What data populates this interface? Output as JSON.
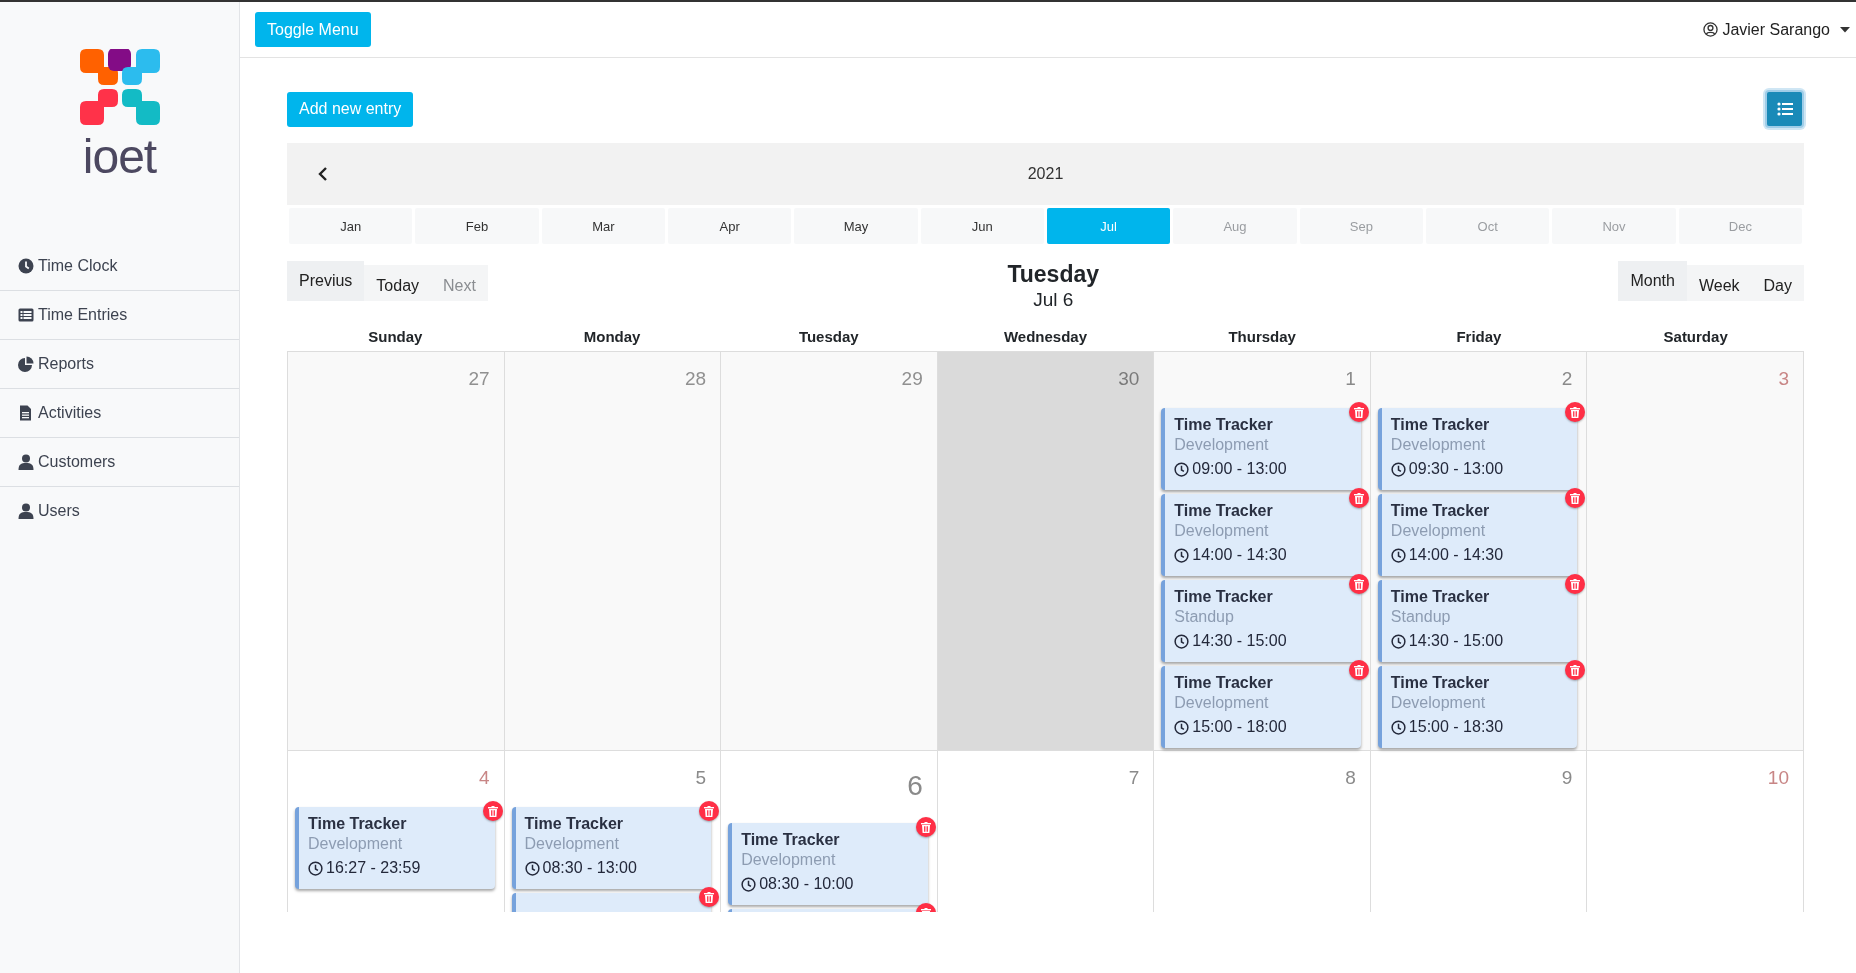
{
  "topbar": {
    "toggle_button": "Toggle Menu",
    "user": "Javier Sarango"
  },
  "sidebar": {
    "logo_text": "ioet",
    "items": [
      {
        "label": "Time Clock",
        "kind": "clock"
      },
      {
        "label": "Time Entries",
        "kind": "list"
      },
      {
        "label": "Reports",
        "kind": "pie"
      },
      {
        "label": "Activities",
        "kind": "file"
      },
      {
        "label": "Customers",
        "kind": "user"
      },
      {
        "label": "Users",
        "kind": "user"
      }
    ]
  },
  "toolbar": {
    "add_button": "Add new entry"
  },
  "calendar": {
    "year": "2021",
    "months": [
      {
        "label": "Jan",
        "selected": false,
        "disabled": false
      },
      {
        "label": "Feb",
        "selected": false,
        "disabled": false
      },
      {
        "label": "Mar",
        "selected": false,
        "disabled": false
      },
      {
        "label": "Apr",
        "selected": false,
        "disabled": false
      },
      {
        "label": "May",
        "selected": false,
        "disabled": false
      },
      {
        "label": "Jun",
        "selected": false,
        "disabled": false
      },
      {
        "label": "Jul",
        "selected": true,
        "disabled": false
      },
      {
        "label": "Aug",
        "selected": false,
        "disabled": true
      },
      {
        "label": "Sep",
        "selected": false,
        "disabled": true
      },
      {
        "label": "Oct",
        "selected": false,
        "disabled": true
      },
      {
        "label": "Nov",
        "selected": false,
        "disabled": true
      },
      {
        "label": "Dec",
        "selected": false,
        "disabled": true
      }
    ],
    "nav": [
      {
        "label": "Previus",
        "selected": true,
        "disabled": false
      },
      {
        "label": "Today",
        "selected": false,
        "disabled": false
      },
      {
        "label": "Next",
        "selected": false,
        "disabled": true
      }
    ],
    "title": {
      "weekday": "Tuesday",
      "date": "Jul 6"
    },
    "views": [
      {
        "label": "Month",
        "selected": true
      },
      {
        "label": "Week",
        "selected": false
      },
      {
        "label": "Day",
        "selected": false
      }
    ],
    "weekdays": [
      "Sunday",
      "Monday",
      "Tuesday",
      "Wednesday",
      "Thursday",
      "Friday",
      "Saturday"
    ],
    "weeks": [
      [
        {
          "number": "27",
          "other_month": true,
          "today": false,
          "highlighted": false
        },
        {
          "number": "28",
          "other_month": true,
          "today": false,
          "highlighted": false
        },
        {
          "number": "29",
          "other_month": true,
          "today": false,
          "highlighted": false
        },
        {
          "number": "30",
          "other_month": true,
          "today": false,
          "highlighted": true
        },
        {
          "number": "1",
          "other_month": false,
          "weekend": false,
          "today": false,
          "highlighted": false,
          "entries": [
            {
              "kind": "entry",
              "title": "Time Tracker",
              "activity": "Development",
              "time": "09:00 - 13:00"
            },
            {
              "kind": "entry",
              "title": "Time Tracker",
              "activity": "Development",
              "time": "14:00 - 14:30"
            },
            {
              "kind": "entry",
              "title": "Time Tracker",
              "activity": "Standup",
              "time": "14:30 - 15:00"
            },
            {
              "kind": "entry",
              "title": "Time Tracker",
              "activity": "Development",
              "time": "15:00 - 18:00"
            }
          ]
        },
        {
          "number": "2",
          "other_month": false,
          "weekend": false,
          "today": false,
          "highlighted": false,
          "entries": [
            {
              "kind": "entry",
              "title": "Time Tracker",
              "activity": "Development",
              "time": "09:30 - 13:00"
            },
            {
              "kind": "entry",
              "title": "Time Tracker",
              "activity": "Development",
              "time": "14:00 - 14:30"
            },
            {
              "kind": "entry",
              "title": "Time Tracker",
              "activity": "Standup",
              "time": "14:30 - 15:00"
            },
            {
              "kind": "entry",
              "title": "Time Tracker",
              "activity": "Development",
              "time": "15:00 - 18:30"
            }
          ]
        },
        {
          "number": "3",
          "other_month": false,
          "weekend": true,
          "today": false,
          "highlighted": false
        }
      ],
      [
        {
          "number": "4",
          "other_month": false,
          "weekend": true,
          "today": false,
          "highlighted": false,
          "entries": [
            {
              "kind": "entry",
              "title": "Time Tracker",
              "activity": "Development",
              "time": "16:27 - 23:59"
            }
          ]
        },
        {
          "number": "5",
          "other_month": false,
          "weekend": false,
          "today": false,
          "highlighted": false,
          "entries": [
            {
              "kind": "entry",
              "title": "Time Tracker",
              "activity": "Development",
              "time": "08:30 - 13:00"
            },
            {
              "kind": "entry"
            }
          ]
        },
        {
          "number": "6",
          "other_month": false,
          "weekend": false,
          "today": true,
          "highlighted": false,
          "entries": [
            {
              "kind": "entry",
              "title": "Time Tracker",
              "activity": "Development",
              "time": "08:30 - 10:00"
            },
            {
              "kind": "entry"
            }
          ]
        },
        {
          "number": "7",
          "other_month": false,
          "weekend": false,
          "today": false,
          "highlighted": false
        },
        {
          "number": "8",
          "other_month": false,
          "weekend": false,
          "today": false,
          "highlighted": false
        },
        {
          "number": "9",
          "other_month": false,
          "weekend": false,
          "today": false,
          "highlighted": false
        },
        {
          "number": "10",
          "other_month": false,
          "weekend": true,
          "today": false,
          "highlighted": false
        }
      ]
    ]
  }
}
